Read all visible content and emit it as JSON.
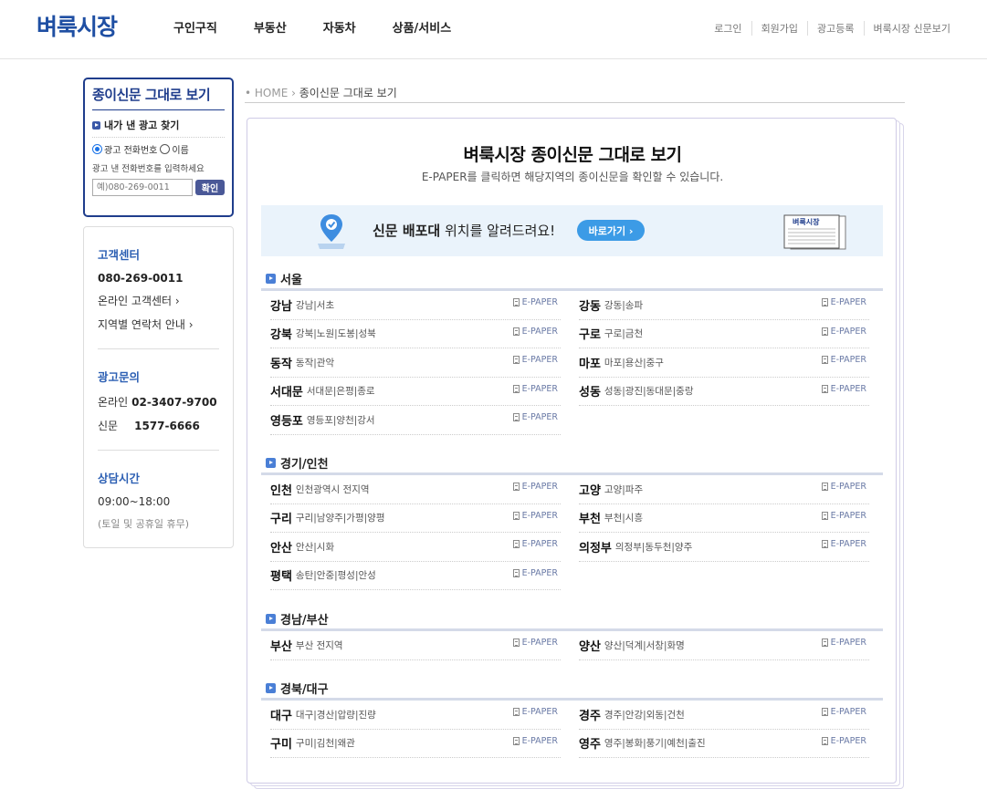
{
  "header": {
    "logo": "벼룩시장",
    "nav": [
      "구인구직",
      "부동산",
      "자동차",
      "상품/서비스"
    ],
    "util": [
      "로그인",
      "회원가입",
      "광고등록",
      "벼룩시장 신문보기"
    ]
  },
  "sidebar": {
    "epaper_title": "종이신문 그대로 보기",
    "find_title": "내가 낸 광고 찾기",
    "radio_phone": "광고 전화번호",
    "radio_name": "이름",
    "hint": "광고 낸 전화번호를 입력하세요",
    "input_placeholder": "예)080-269-0011",
    "confirm": "확인",
    "cs": {
      "title": "고객센터",
      "phone": "080-269-0011",
      "online": "온라인 고객센터 ›",
      "regional": "지역별 연락처 안내 ›"
    },
    "ad": {
      "title": "광고문의",
      "online_label": "온라인",
      "online_num": "02-3407-9700",
      "paper_label": "신문",
      "paper_num": "1577-6666"
    },
    "hours": {
      "title": "상담시간",
      "time": "09:00~18:00",
      "note": "(토일 및 공휴일 휴무)"
    }
  },
  "breadcrumb": {
    "home": "• HOME",
    "sep": "›",
    "current": "종이신문 그대로 보기"
  },
  "main": {
    "title": "벼룩시장 종이신문 그대로 보기",
    "subtitle": "E-PAPER를 클릭하면 해당지역의 종이신문을 확인할 수 있습니다.",
    "banner_bold": "신문 배포대",
    "banner_rest": " 위치를 알려드려요!",
    "banner_button": "바로가기 ›",
    "newspaper_label": "벼룩시장",
    "epaper": "E-PAPER",
    "regions": [
      {
        "name": "서울",
        "cities": [
          {
            "name": "강남",
            "sub": "강남|서초"
          },
          {
            "name": "강동",
            "sub": "강동|송파"
          },
          {
            "name": "강북",
            "sub": "강북|노원|도봉|성북"
          },
          {
            "name": "구로",
            "sub": "구로|금천"
          },
          {
            "name": "동작",
            "sub": "동작|관악"
          },
          {
            "name": "마포",
            "sub": "마포|용산|중구"
          },
          {
            "name": "서대문",
            "sub": "서대문|은평|종로"
          },
          {
            "name": "성동",
            "sub": "성동|광진|동대문|중랑"
          },
          {
            "name": "영등포",
            "sub": "영등포|양천|강서"
          }
        ]
      },
      {
        "name": "경기/인천",
        "cities": [
          {
            "name": "인천",
            "sub": "인천광역시 전지역"
          },
          {
            "name": "고양",
            "sub": "고양|파주"
          },
          {
            "name": "구리",
            "sub": "구리|남양주|가평|양평"
          },
          {
            "name": "부천",
            "sub": "부천|시흥"
          },
          {
            "name": "안산",
            "sub": "안산|시화"
          },
          {
            "name": "의정부",
            "sub": "의정부|동두천|양주"
          },
          {
            "name": "평택",
            "sub": "송탄|안중|평성|안성"
          }
        ]
      },
      {
        "name": "경남/부산",
        "cities": [
          {
            "name": "부산",
            "sub": "부산 전지역"
          },
          {
            "name": "양산",
            "sub": "양산|덕계|서창|화명"
          }
        ]
      },
      {
        "name": "경북/대구",
        "cities": [
          {
            "name": "대구",
            "sub": "대구|경산|압량|진량"
          },
          {
            "name": "경주",
            "sub": "경주|안강|외동|건천"
          },
          {
            "name": "구미",
            "sub": "구미|김천|왜관"
          },
          {
            "name": "영주",
            "sub": "영주|봉화|풍기|예천|출진"
          }
        ]
      }
    ]
  }
}
